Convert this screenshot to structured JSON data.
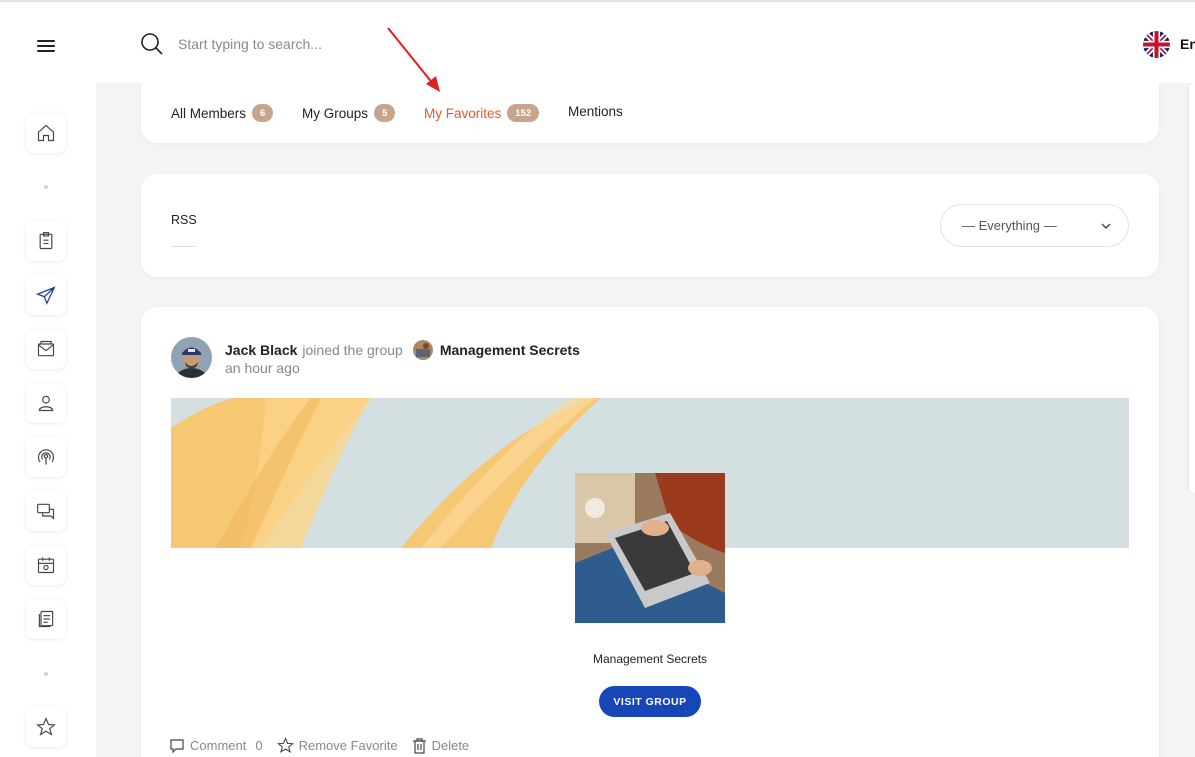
{
  "header": {
    "search_placeholder": "Start typing to search...",
    "language_label": "En"
  },
  "tabs": [
    {
      "label": "All Members",
      "count": "6"
    },
    {
      "label": "My Groups",
      "count": "5"
    },
    {
      "label": "My Favorites",
      "count": "152",
      "active": true
    },
    {
      "label": "Mentions"
    }
  ],
  "filter": {
    "rss_label": "RSS",
    "select_value": "— Everything —"
  },
  "activity": {
    "user": "Jack Black",
    "action": "joined the group",
    "group": "Management Secrets",
    "time": "an hour ago",
    "group_card_name": "Management Secrets",
    "visit_button": "VISIT GROUP",
    "comment_label": "Comment",
    "comment_count": "0",
    "favorite_label": "Remove Favorite",
    "delete_label": "Delete"
  },
  "sidebar": {
    "icons": [
      "home-icon",
      "clipboard-icon",
      "send-icon",
      "mail-icon",
      "user-icon",
      "broadcast-icon",
      "chat-icon",
      "calendar-icon",
      "document-icon",
      "star-icon"
    ]
  },
  "colors": {
    "active_tab": "#e8582a",
    "badge": "#c7a58c",
    "primary_button": "#1746b8",
    "annotation_arrow": "#e02020"
  }
}
